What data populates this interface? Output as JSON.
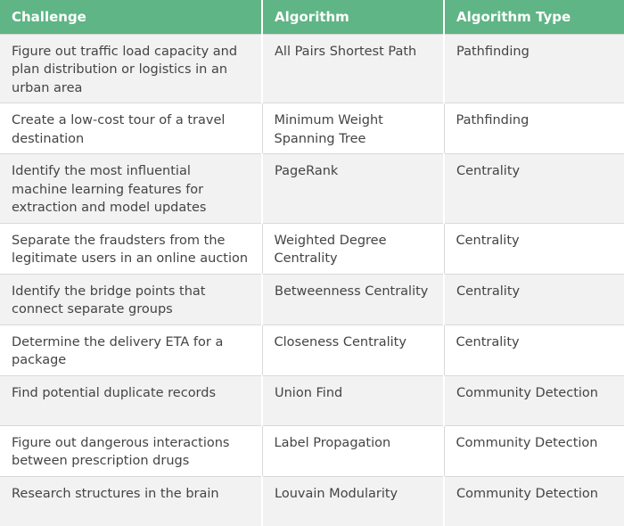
{
  "colors": {
    "header_bg": "#5fb585",
    "header_text": "#ffffff",
    "row_alt_bg": "#f2f2f2",
    "row_bg": "#ffffff",
    "cell_text": "#444444"
  },
  "table": {
    "headers": [
      "Challenge",
      "Algorithm",
      "Algorithm Type"
    ],
    "rows": [
      [
        "Figure out traffic load capacity and plan distribution or logistics in an urban area",
        "All Pairs Shortest Path",
        "Pathfinding"
      ],
      [
        "Create a low-cost tour of a travel destination",
        "Minimum Weight Spanning Tree",
        "Pathfinding"
      ],
      [
        "Identify the most influential machine learning features for extraction and model updates",
        "PageRank",
        "Centrality"
      ],
      [
        "Separate the fraudsters from the legitimate users in an online auction",
        "Weighted Degree Centrality",
        "Centrality"
      ],
      [
        "Identify the bridge points that connect separate groups",
        "Betweenness Centrality",
        "Centrality"
      ],
      [
        "Determine the delivery ETA for a package",
        "Closeness Centrality",
        "Centrality"
      ],
      [
        "Find potential duplicate records",
        "Union Find",
        "Community Detection"
      ],
      [
        "Figure out dangerous interactions between prescription drugs",
        "Label Propagation",
        "Community Detection"
      ],
      [
        "Research structures in the brain",
        "Louvain Modularity",
        "Community Detection"
      ]
    ]
  }
}
